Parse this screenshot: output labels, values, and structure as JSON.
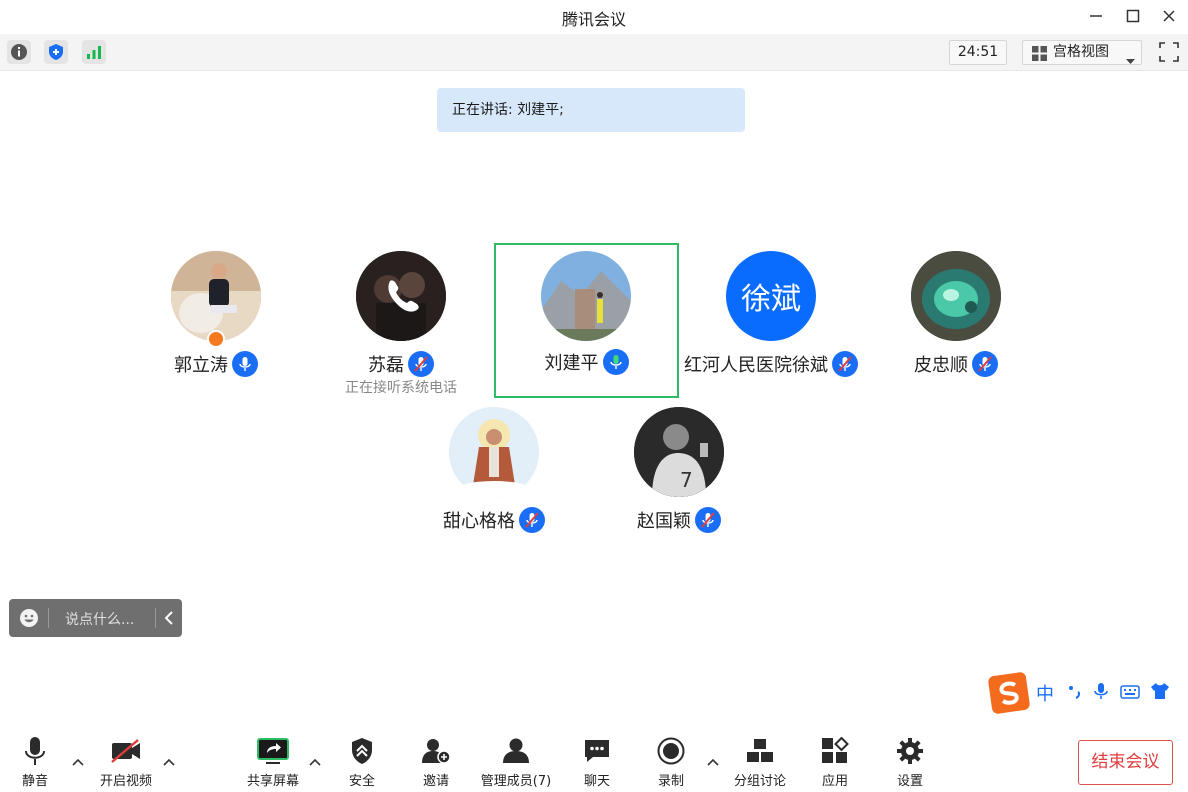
{
  "window": {
    "title": "腾讯会议"
  },
  "toolbar": {
    "timer": "24:51",
    "view_mode": "宫格视图"
  },
  "speaking_banner": "正在讲话: 刘建平;",
  "participants": [
    {
      "name": "郭立涛",
      "mic": "active-blue",
      "sub": ""
    },
    {
      "name": "苏磊",
      "mic": "muted",
      "sub": "正在接听系统电话"
    },
    {
      "name": "刘建平",
      "mic": "speaking-green",
      "sub": ""
    },
    {
      "name": "红河人民医院徐斌",
      "mic": "muted",
      "sub": "",
      "avatar_text": "徐斌"
    },
    {
      "name": "皮忠顺",
      "mic": "muted",
      "sub": ""
    },
    {
      "name": "甜心格格",
      "mic": "muted",
      "sub": ""
    },
    {
      "name": "赵国颖",
      "mic": "muted",
      "sub": ""
    }
  ],
  "chat": {
    "placeholder": "说点什么..."
  },
  "ime": {
    "lang": "中"
  },
  "bottom": {
    "mute": "静音",
    "video": "开启视频",
    "share": "共享屏幕",
    "security": "安全",
    "invite": "邀请",
    "members": "管理成员(7)",
    "chat": "聊天",
    "record": "录制",
    "breakout": "分组讨论",
    "apps": "应用",
    "settings": "设置",
    "end": "结束会议"
  },
  "colors": {
    "accent": "#0a6cff",
    "speaking": "#2dbb63",
    "end": "#e03c3c"
  }
}
